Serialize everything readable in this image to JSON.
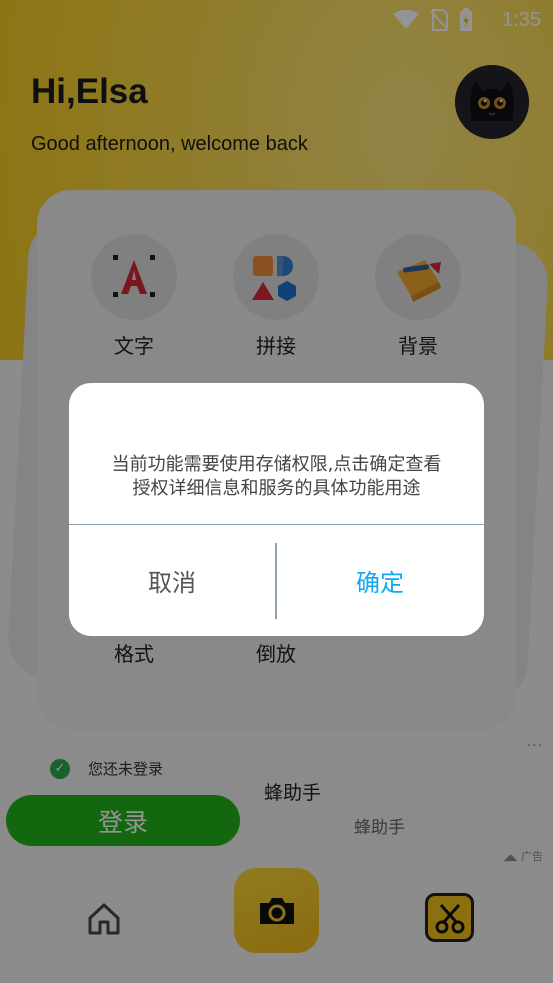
{
  "status_bar": {
    "time": "1:35"
  },
  "header": {
    "greeting": "Hi,Elsa",
    "subtitle": "Good afternoon, welcome back"
  },
  "tools": [
    {
      "label": "文字",
      "icon": "text-icon"
    },
    {
      "label": "拼接",
      "icon": "collage-icon"
    },
    {
      "label": "背景",
      "icon": "background-icon"
    },
    {
      "label": "格式",
      "icon": "format-icon"
    },
    {
      "label": "倒放",
      "icon": "reverse-icon"
    }
  ],
  "ad": {
    "more": "···",
    "login_tip": "您还未登录",
    "title": "蜂助手",
    "login_button": "登录",
    "subtitle": "蜂助手",
    "tag": "广告"
  },
  "dialog": {
    "message_line1": "当前功能需要使用存储权限,点击确定查看",
    "message_line2": "授权详细信息和服务的具体功能用途",
    "cancel": "取消",
    "confirm": "确定"
  },
  "colors": {
    "accent_yellow": "#f5cf2e",
    "confirm_blue": "#12a8f0",
    "login_green": "#22b21b"
  }
}
